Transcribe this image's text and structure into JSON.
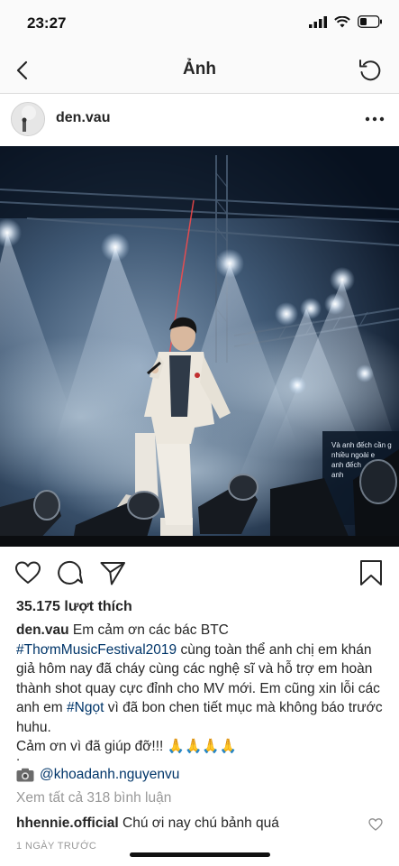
{
  "status": {
    "time": "23:27"
  },
  "nav": {
    "title": "Ảnh"
  },
  "post": {
    "username": "den.vau",
    "likes": "35.175 lượt thích",
    "caption": {
      "text_1": "Em cảm ơn các bác BTC",
      "hashtag_1": "#ThơmMusicFestival2019",
      "text_2": "cùng toàn thể anh chị em khán giả hôm nay đã cháy cùng các nghệ sĩ và hỗ trợ em hoàn thành shot quay cực đỉnh cho MV mới. Em cũng xin lỗi các anh em",
      "hashtag_2": "#Ngọt",
      "text_3": "vì đã bon chen tiết mục mà không báo trước huhu.",
      "text_4": "Cảm ơn vì đã giúp đỡ!!! 🙏🙏🙏🙏",
      "dot": "."
    },
    "credit": "@khoadanh.nguyenvu",
    "view_all": "Xem tất cả 318 bình luận",
    "comment": {
      "username": "hhennie.official",
      "text": "Chú ơi nay chú bảnh quá"
    },
    "time_ago": "1 NGÀY TRƯỚC"
  },
  "stage_screen": {
    "line1": "Và anh đếch cần g",
    "line2": "nhiều ngoài e",
    "line3": "anh  đếch",
    "line4": "anh"
  },
  "colors": {
    "hashtag": "#003569",
    "secondary": "#999999",
    "divider": "#dbdbdb"
  }
}
